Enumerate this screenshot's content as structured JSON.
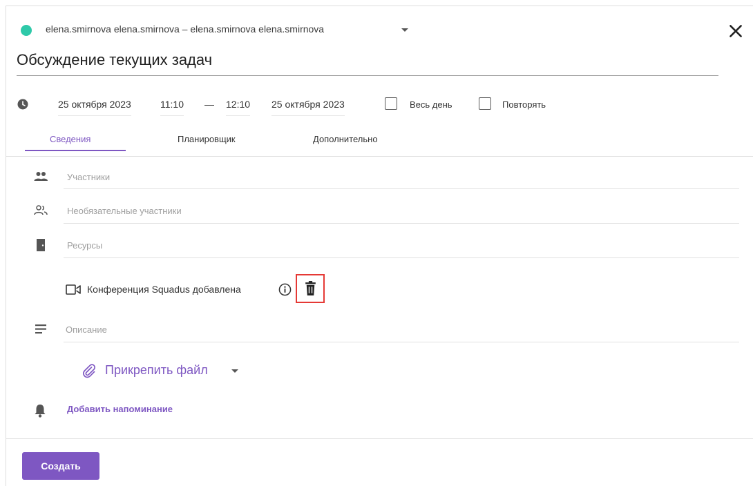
{
  "header": {
    "calendar_color": "#2ec9a9",
    "calendar_name": "elena.smirnova elena.smirnova – elena.smirnova elena.smirnova",
    "close_icon": "close-icon",
    "title": "Обсуждение текущих задач"
  },
  "datetime": {
    "start_date": "25 октября 2023",
    "start_time": "11:10",
    "separator": "—",
    "end_time": "12:10",
    "end_date": "25 октября 2023",
    "all_day_label": "Весь день",
    "all_day_checked": false,
    "repeat_label": "Повторять",
    "repeat_checked": false
  },
  "tabs": [
    {
      "label": "Сведения",
      "active": true
    },
    {
      "label": "Планировщик",
      "active": false
    },
    {
      "label": "Дополнительно",
      "active": false
    }
  ],
  "fields": {
    "participants_placeholder": "Участники",
    "optional_participants_placeholder": "Необязательные участники",
    "resources_placeholder": "Ресурсы",
    "conference_label": "Конференция Squadus добавлена",
    "description_placeholder": "Описание"
  },
  "attach": {
    "label": "Прикрепить файл"
  },
  "reminder": {
    "label": "Добавить напоминание"
  },
  "footer": {
    "create_label": "Создать"
  },
  "colors": {
    "accent": "#7e57c2",
    "highlight": "#e53935"
  }
}
